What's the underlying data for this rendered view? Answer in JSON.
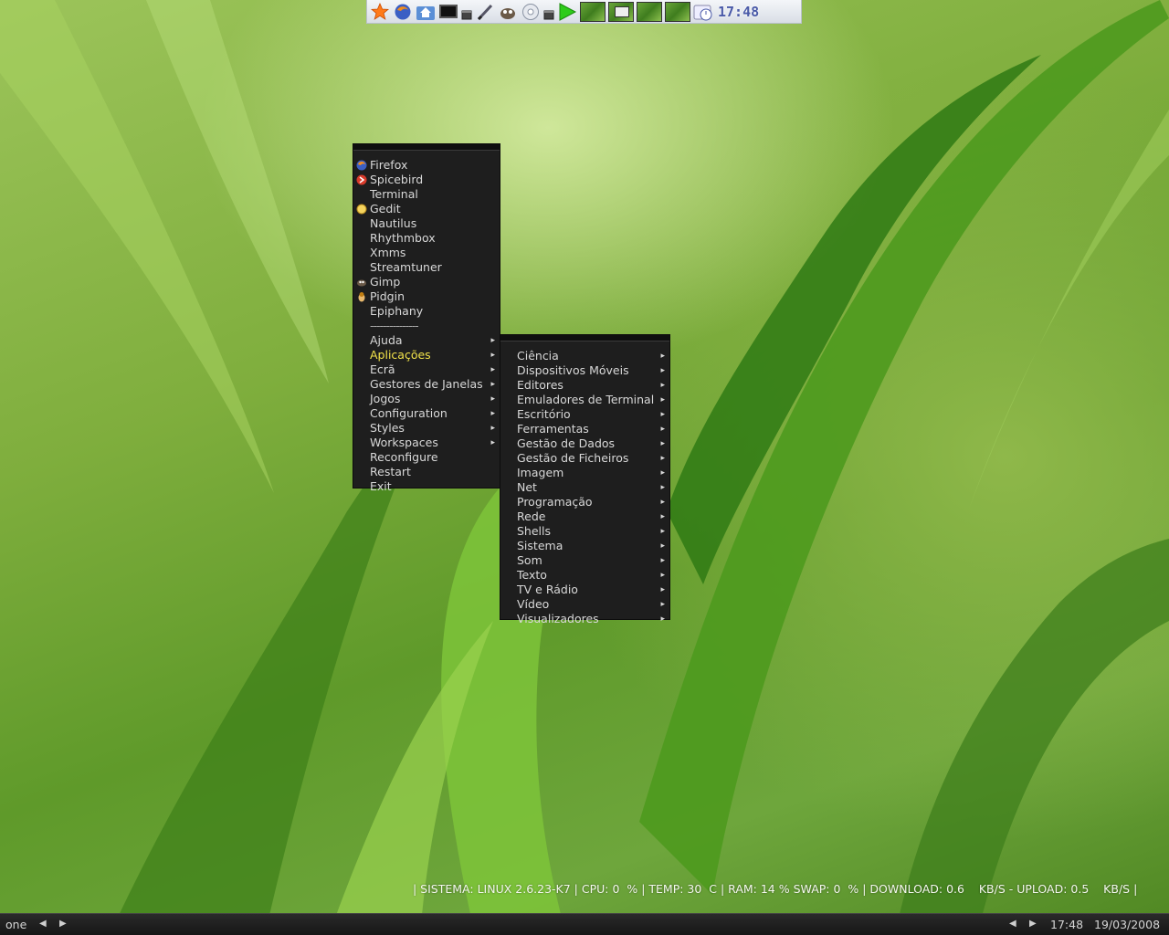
{
  "top_bar": {
    "icons": [
      "star-icon",
      "firefox-icon",
      "home-folder-icon",
      "terminal-icon",
      "window-icon",
      "pen-icon",
      "gimp-icon",
      "cd-icon",
      "window-icon",
      "play-icon"
    ],
    "workspaces": 4,
    "clock": "17:48"
  },
  "root_menu": {
    "items": [
      {
        "label": "Firefox",
        "icon": "firefox-icon"
      },
      {
        "label": "Spicebird",
        "icon": "spicebird-icon"
      },
      {
        "label": "Terminal"
      },
      {
        "label": "Gedit",
        "icon": "gedit-icon"
      },
      {
        "label": "Nautilus"
      },
      {
        "label": "Rhythmbox"
      },
      {
        "label": "Xmms"
      },
      {
        "label": "Streamtuner"
      },
      {
        "label": "Gimp",
        "icon": "gimp-icon"
      },
      {
        "label": "Pidgin",
        "icon": "pidgin-icon"
      },
      {
        "label": "Epiphany"
      },
      {
        "label": "---------------",
        "separator": true
      },
      {
        "label": "Ajuda",
        "submenu": true
      },
      {
        "label": "Aplicações",
        "submenu": true,
        "active": true
      },
      {
        "label": "Ecrã",
        "submenu": true
      },
      {
        "label": "Gestores de Janelas",
        "submenu": true
      },
      {
        "label": "Jogos",
        "submenu": true
      },
      {
        "label": "Configuration",
        "submenu": true
      },
      {
        "label": "Styles",
        "submenu": true
      },
      {
        "label": "Workspaces",
        "submenu": true
      },
      {
        "label": "Reconfigure"
      },
      {
        "label": "Restart"
      },
      {
        "label": "Exit"
      }
    ]
  },
  "sub_menu": {
    "items": [
      "Ciência",
      "Dispositivos Móveis",
      "Editores",
      "Emuladores de Terminal",
      "Escritório",
      "Ferramentas",
      "Gestão de Dados",
      "Gestão de Ficheiros",
      "Imagem",
      "Net",
      "Programação",
      "Rede",
      "Shells",
      "Sistema",
      "Som",
      "Texto",
      "TV e Rádio",
      "Vídeo",
      "Visualizadores"
    ]
  },
  "conky": {
    "text": "| SISTEMA: LINUX 2.6.23-K7 | CPU: 0  % | TEMP: 30  C | RAM: 14 % SWAP: 0  % | DOWNLOAD: 0.6    KB/S - UPLOAD: 0.5    KB/S |"
  },
  "bottom_bar": {
    "workspace_name": "one",
    "time": "17:48",
    "date": "19/03/2008"
  },
  "colors": {
    "menu_bg": "#1e1e1e",
    "menu_text": "#d8d8d8",
    "active_text": "#f2e34a",
    "panel_bg": "#1c1c1c"
  }
}
